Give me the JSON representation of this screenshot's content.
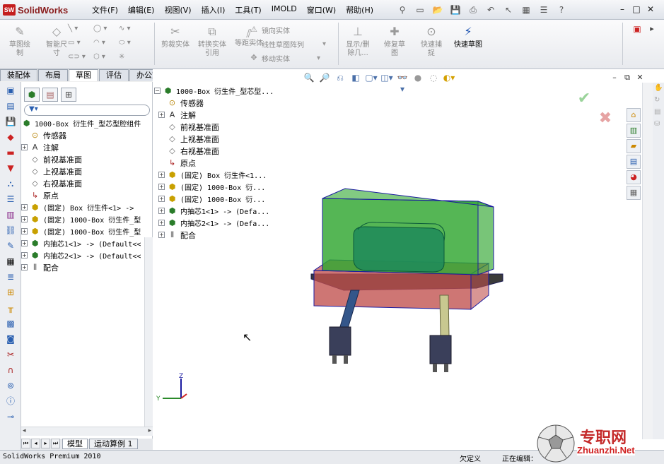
{
  "app": {
    "logo_text": "SolidWorks",
    "logo_badge": "SW"
  },
  "menu": [
    "文件(F)",
    "编辑(E)",
    "视图(V)",
    "插入(I)",
    "工具(T)",
    "IMOLD",
    "窗口(W)",
    "帮助(H)"
  ],
  "commands": {
    "sketch_draw": "草图绘制",
    "smart_dim": "智能尺寸",
    "trim": "剪裁实体",
    "convert": "转换实体引用",
    "offset": "等距实体",
    "mirror": "镜向实体",
    "linear_pattern": "线性草图阵列",
    "move": "移动实体",
    "display_delete": "显示/删除几...",
    "repair": "修复草图",
    "quick_snap": "快速捕捉",
    "rapid_sketch": "快速草图"
  },
  "cm_tabs": [
    "装配体",
    "布局",
    "草图",
    "评估",
    "办公室产品"
  ],
  "cm_active_tab": "草图",
  "feature_tree": {
    "root": "1000-Box 衍生件_型芯型腔组件",
    "items": [
      {
        "label": "传感器",
        "icon": "sensor-icon",
        "expandable": false
      },
      {
        "label": "注解",
        "icon": "annotation-icon",
        "expandable": true
      },
      {
        "label": "前视基准面",
        "icon": "plane-icon",
        "expandable": false
      },
      {
        "label": "上视基准面",
        "icon": "plane-icon",
        "expandable": false
      },
      {
        "label": "右视基准面",
        "icon": "plane-icon",
        "expandable": false
      },
      {
        "label": "原点",
        "icon": "origin-icon",
        "expandable": false
      },
      {
        "label": "(固定) Box 衍生件<1> ->",
        "icon": "part-icon",
        "expandable": true
      },
      {
        "label": "(固定) 1000-Box 衍生件_型",
        "icon": "part-icon",
        "expandable": true
      },
      {
        "label": "(固定) 1000-Box 衍生件_型",
        "icon": "part-icon",
        "expandable": true
      },
      {
        "label": "内抽芯1<1> -> (Default<<",
        "icon": "assembly-icon",
        "expandable": true
      },
      {
        "label": "内抽芯2<1> -> (Default<<",
        "icon": "assembly-icon",
        "expandable": true
      },
      {
        "label": "配合",
        "icon": "mate-icon",
        "expandable": true
      }
    ]
  },
  "gfx_tree": {
    "root": "1000-Box 衍生件_型芯型...",
    "items": [
      {
        "label": "传感器",
        "icon": "sensor-icon",
        "expandable": false
      },
      {
        "label": "注解",
        "icon": "annotation-icon",
        "expandable": true
      },
      {
        "label": "前视基准面",
        "icon": "plane-icon",
        "expandable": false
      },
      {
        "label": "上视基准面",
        "icon": "plane-icon",
        "expandable": false
      },
      {
        "label": "右视基准面",
        "icon": "plane-icon",
        "expandable": false
      },
      {
        "label": "原点",
        "icon": "origin-icon",
        "expandable": false
      },
      {
        "label": "(固定) Box 衍生件<1...",
        "icon": "part-icon",
        "expandable": true
      },
      {
        "label": "(固定) 1000-Box 衍...",
        "icon": "part-icon",
        "expandable": true
      },
      {
        "label": "(固定) 1000-Box 衍...",
        "icon": "part-icon",
        "expandable": true
      },
      {
        "label": "内抽芯1<1> -> (Defa...",
        "icon": "assembly-icon",
        "expandable": true
      },
      {
        "label": "内抽芯2<1> -> (Defa...",
        "icon": "assembly-icon",
        "expandable": true
      },
      {
        "label": "配合",
        "icon": "mate-icon",
        "expandable": true
      }
    ]
  },
  "bottom_tabs": [
    "模型",
    "运动算例 1"
  ],
  "status": {
    "version": "SolidWorks Premium 2010",
    "state": "欠定义",
    "editing": "正在编辑："
  },
  "triad": {
    "z": "Z",
    "y": "Y"
  },
  "watermark": {
    "text": "专职网",
    "url": "Zhuanzhi.Net"
  },
  "colors": {
    "top_plate": "#2fa62f",
    "bottom_plate": "#c0504d",
    "edge": "#1a1aa0"
  }
}
